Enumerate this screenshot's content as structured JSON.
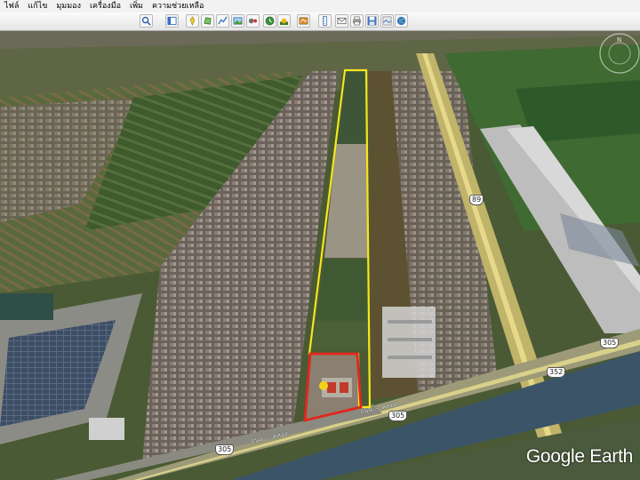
{
  "menu": {
    "items": [
      "ไฟล์",
      "แก้ไข",
      "มุมมอง",
      "เครื่องมือ",
      "เพิ่ม",
      "ความช่วยเหลือ"
    ]
  },
  "toolbar": {
    "buttons": [
      {
        "name": "search-icon"
      },
      {
        "name": "sidebar-toggle-icon"
      },
      {
        "name": "placemark-icon"
      },
      {
        "name": "polygon-icon"
      },
      {
        "name": "path-icon"
      },
      {
        "name": "image-overlay-icon"
      },
      {
        "name": "record-tour-icon"
      },
      {
        "name": "historical-imagery-icon"
      },
      {
        "name": "sunlight-icon"
      },
      {
        "name": "switch-planet-icon"
      },
      {
        "name": "ruler-icon"
      },
      {
        "name": "email-icon"
      },
      {
        "name": "print-icon"
      },
      {
        "name": "save-image-icon"
      },
      {
        "name": "view-in-maps-icon"
      }
    ]
  },
  "map": {
    "logo_text": "Google Earth",
    "route_shields": [
      "305",
      "305",
      "352",
      "305",
      "89"
    ],
    "road_labels": [
      "ถนน..-..คลอง",
      "ถนน..-..คลอง"
    ],
    "colors": {
      "boundary_yellow": "#f6e61a",
      "boundary_red": "#e2261e"
    }
  }
}
